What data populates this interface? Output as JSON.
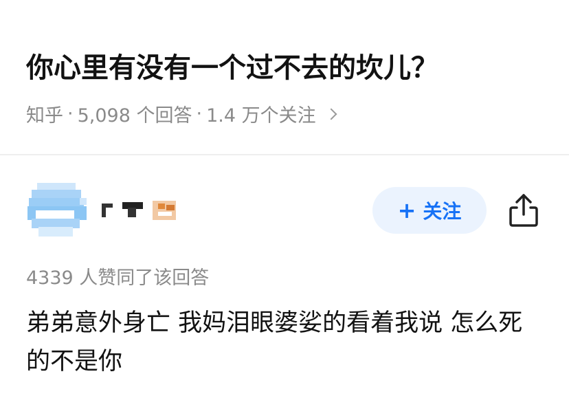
{
  "question": {
    "title": "你心里有没有一个过不去的坎儿？",
    "source": "知乎",
    "answer_count": "5,098 个回答",
    "follower_count": "1.4 万个关注",
    "separator": "·"
  },
  "answer": {
    "follow_label": "关注",
    "follow_plus": "+",
    "upvote_text": "4339 人赞同了该回答",
    "body": "弟弟意外身亡 我妈泪眼婆娑的看着我说 怎么死的不是你"
  },
  "colors": {
    "accent": "#1772f6",
    "follow_bg": "#ebf3fe",
    "title_text": "#121212",
    "meta_text": "#8a8a8a"
  },
  "icons": {
    "share": "share-icon",
    "meta_chevron": "chevron-right-icon"
  }
}
